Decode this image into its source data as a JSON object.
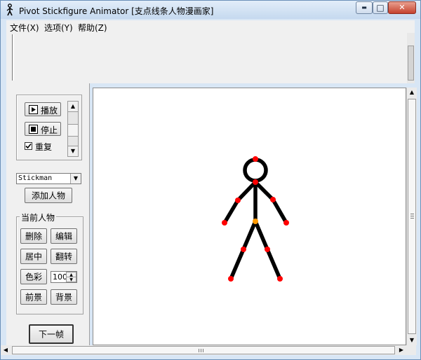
{
  "window": {
    "title": "Pivot Stickfigure Animator [支点线条人物漫画家]",
    "min_glyph": "▬",
    "max_glyph": "□",
    "close_glyph": "✕"
  },
  "menu": [
    {
      "label": "文件(X)"
    },
    {
      "label": "选项(Y)"
    },
    {
      "label": "帮助(Z)"
    }
  ],
  "playback": {
    "play_label": "播放",
    "stop_label": "停止",
    "repeat_label": "重复",
    "repeat_checked": true
  },
  "figure_select": {
    "value": "Stickman"
  },
  "add_figure_label": "添加人物",
  "current_figure": {
    "group_label": "当前人物",
    "delete_label": "删除",
    "edit_label": "编辑",
    "center_label": "居中",
    "flip_label": "翻转",
    "color_label": "色彩",
    "size_value": "100",
    "front_label": "前景",
    "back_label": "背景"
  },
  "next_frame_label": "下一帧",
  "colors": {
    "joint": "#ff0000",
    "center_joint": "#ff9900",
    "limb": "#000000"
  }
}
